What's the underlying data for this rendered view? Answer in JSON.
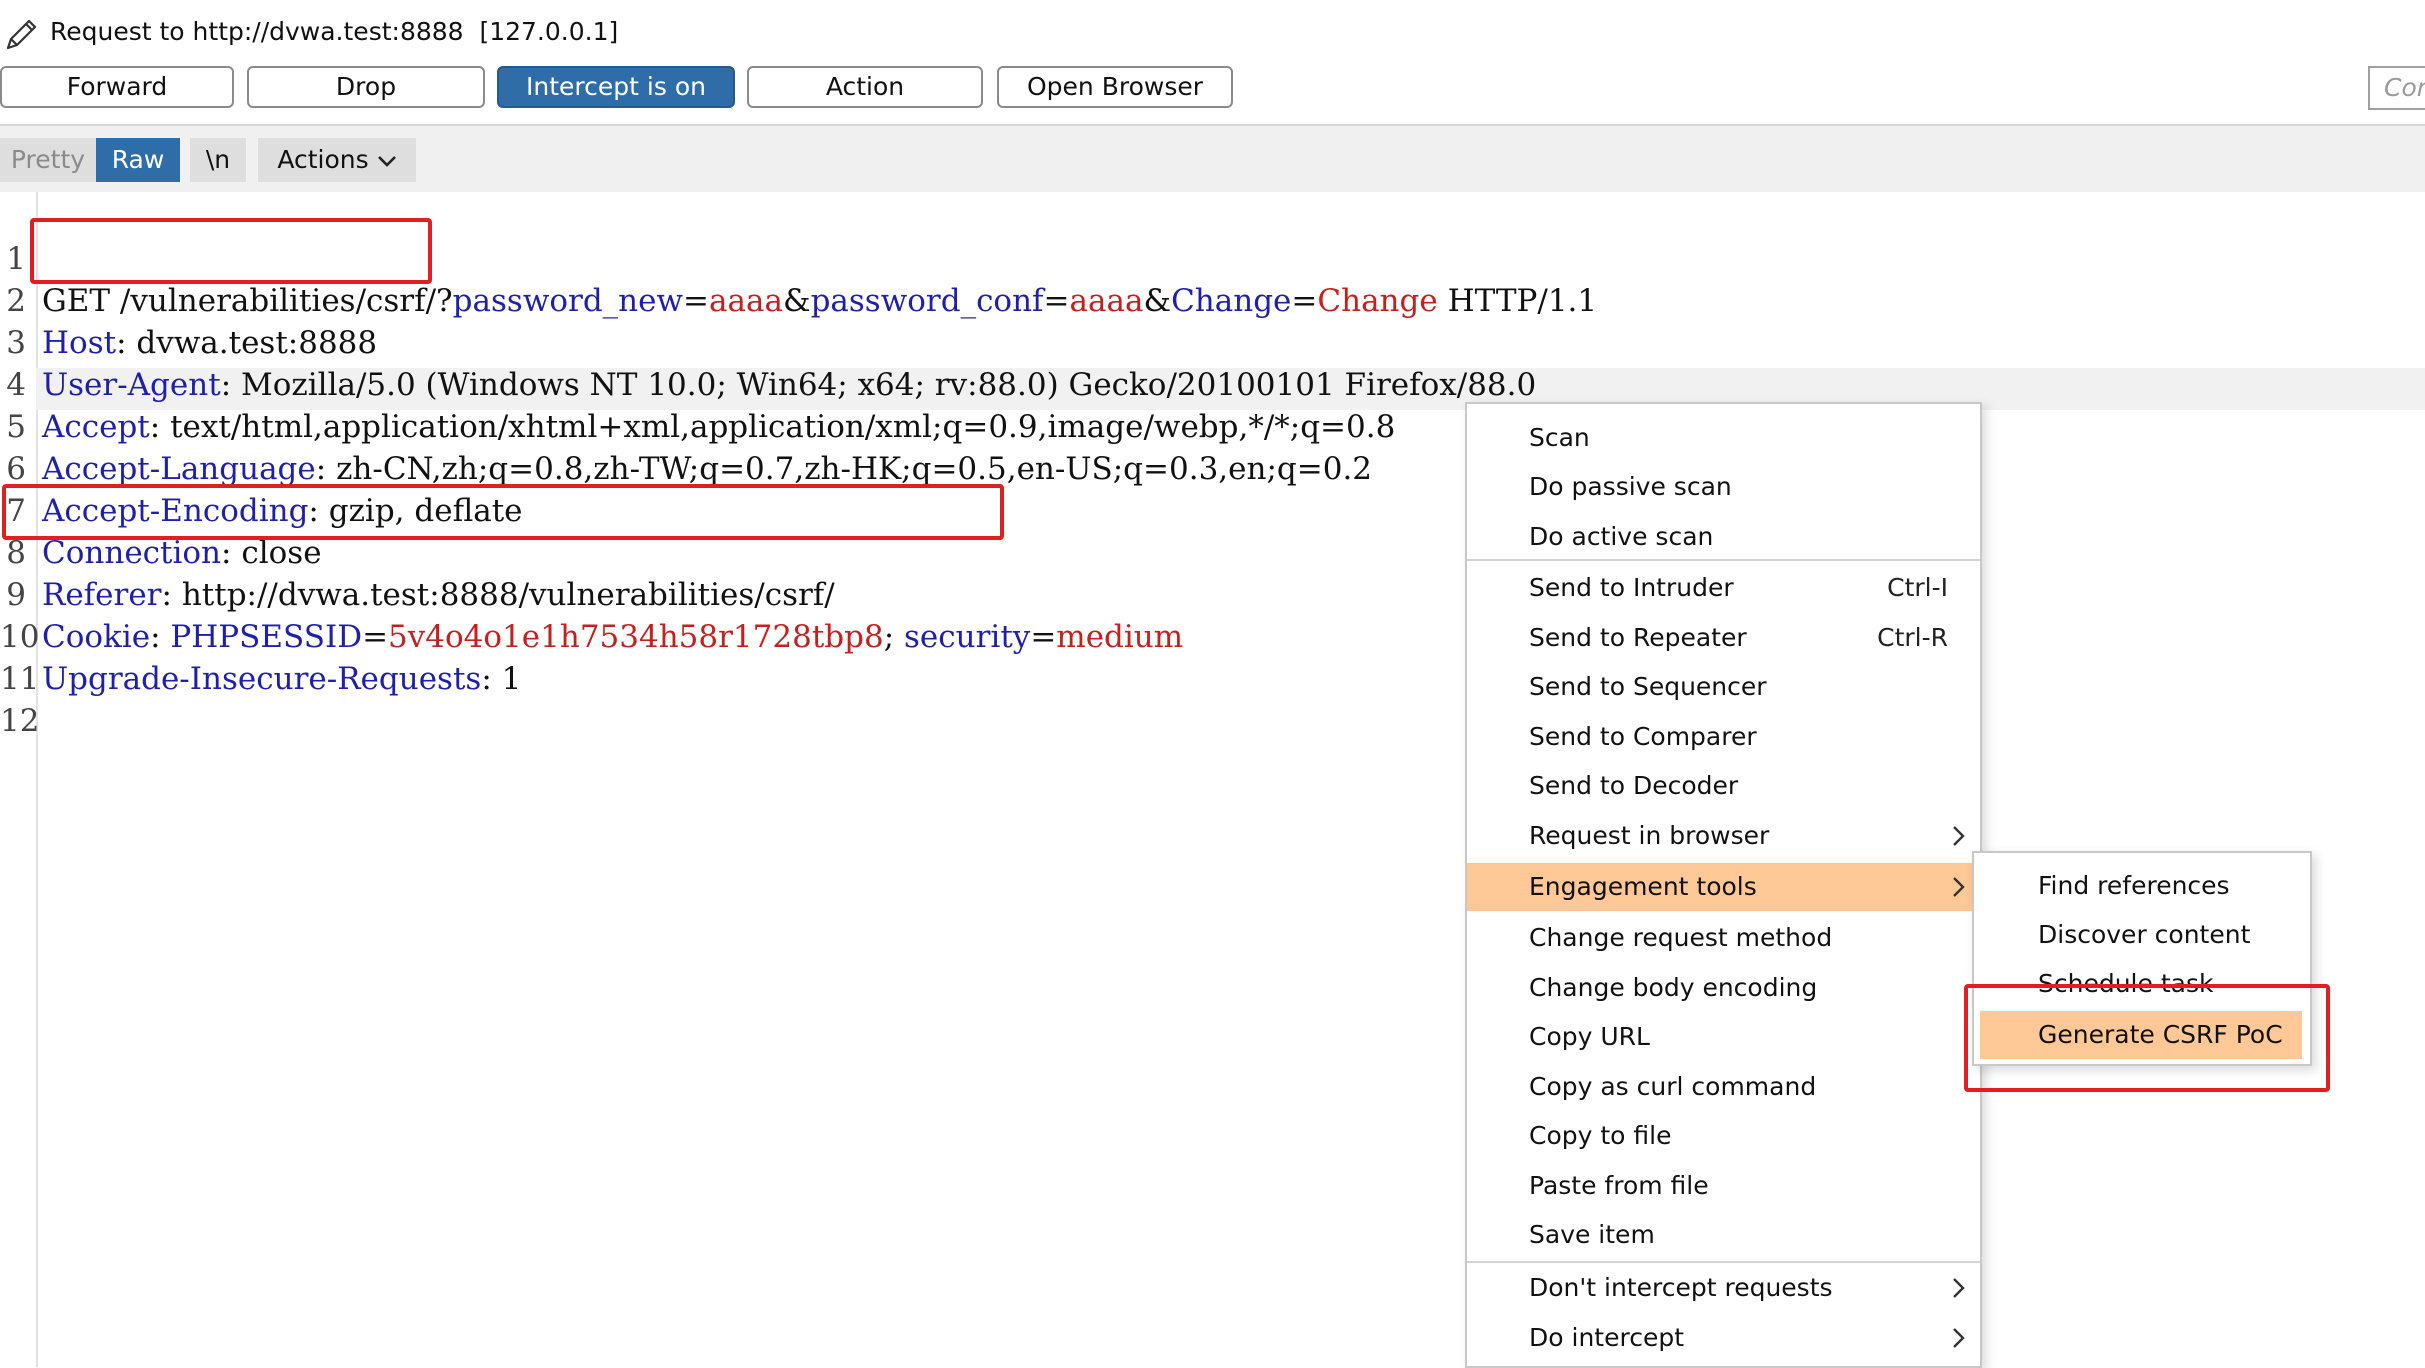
{
  "window": {
    "title": "Request to http://dvwa.test:8888  [127.0.0.1]",
    "icon": "pencil-icon"
  },
  "toolbar": {
    "forward": "Forward",
    "drop": "Drop",
    "intercept": "Intercept is on",
    "action": "Action",
    "open_browser": "Open Browser",
    "comment_placeholder": "Comment this item"
  },
  "editor_tabs": {
    "pretty": "Pretty",
    "raw": "Raw",
    "newline": "\\n",
    "actions": "Actions",
    "actions_icon": "chevron-down-icon"
  },
  "request": {
    "line_numbers": [
      "1",
      "2",
      "3",
      "4",
      "5",
      "6",
      "7",
      "8",
      "9",
      "10",
      "11",
      "12"
    ],
    "request_line": {
      "method_path": "GET /vulnerabilities/csrf/?",
      "param1": "password_new",
      "val1": "aaaa",
      "param2": "password_conf",
      "val2": "aaaa",
      "param3": "Change",
      "val3": "Change",
      "version": " HTTP/1.1"
    },
    "headers": [
      {
        "name": "Host",
        "value": "dvwa.test:8888"
      },
      {
        "name": "User-Agent",
        "value": "Mozilla/5.0 (Windows NT 10.0; Win64; x64; rv:88.0) Gecko/20100101 Firefox/88.0"
      },
      {
        "name": "Accept",
        "value": "text/html,application/xhtml+xml,application/xml;q=0.9,image/webp,*/*;q=0.8"
      },
      {
        "name": "Accept-Language",
        "value": "zh-CN,zh;q=0.8,zh-TW;q=0.7,zh-HK;q=0.5,en-US;q=0.3,en;q=0.2"
      },
      {
        "name": "Accept-Encoding",
        "value": "gzip, deflate"
      },
      {
        "name": "Connection",
        "value": "close"
      },
      {
        "name": "Referer",
        "value": "http://dvwa.test:8888/vulnerabilities/csrf/"
      }
    ],
    "cookie": {
      "name": "Cookie",
      "c1_name": "PHPSESSID",
      "c1_value": "5v4o4o1e1h7534h58r1728tbp8",
      "c2_name": "security",
      "c2_value": "medium"
    },
    "upgrade": {
      "name": "Upgrade-Insecure-Requests",
      "value": "1"
    }
  },
  "context_menu": {
    "items": [
      {
        "label": "Scan"
      },
      {
        "label": "Do passive scan"
      },
      {
        "label": "Do active scan"
      },
      {
        "label": "Send to Intruder",
        "shortcut": "Ctrl-I"
      },
      {
        "label": "Send to Repeater",
        "shortcut": "Ctrl-R"
      },
      {
        "label": "Send to Sequencer"
      },
      {
        "label": "Send to Comparer"
      },
      {
        "label": "Send to Decoder"
      },
      {
        "label": "Request in browser",
        "submenu": true
      },
      {
        "label": "Engagement tools",
        "submenu": true,
        "highlighted": true
      },
      {
        "label": "Change request method"
      },
      {
        "label": "Change body encoding"
      },
      {
        "label": "Copy URL"
      },
      {
        "label": "Copy as curl command"
      },
      {
        "label": "Copy to file"
      },
      {
        "label": "Paste from file"
      },
      {
        "label": "Save item"
      },
      {
        "label": "Don't intercept requests",
        "submenu": true
      },
      {
        "label": "Do intercept",
        "submenu": true
      }
    ]
  },
  "submenu": {
    "items": [
      {
        "label": "Find references"
      },
      {
        "label": "Discover content"
      },
      {
        "label": "Schedule task"
      },
      {
        "label": "Generate CSRF PoC",
        "highlighted": true
      }
    ]
  },
  "colors": {
    "accent": "#2f6da8",
    "highlight": "#ffc896",
    "annotation": "#e02020",
    "header_name": "#1f1fa8",
    "param_value": "#c42020"
  }
}
